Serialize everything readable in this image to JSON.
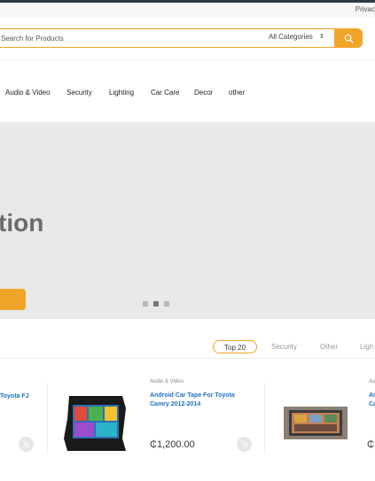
{
  "topbar": {
    "privacy_label": "Privac"
  },
  "search": {
    "placeholder": "Search for Products",
    "category_value": "All Categories",
    "category_arrow": "⇕"
  },
  "nav": {
    "items": [
      "Audio & Video",
      "Security",
      "Lighting",
      "Car Care",
      "Decor",
      "other"
    ]
  },
  "hero": {
    "title_fragment": "tion",
    "slide_count": 3,
    "active_slide": 2
  },
  "tabs": {
    "items": [
      "Top 20",
      "Security",
      "Other",
      "Ligh"
    ],
    "active_index": 0
  },
  "products": [
    {
      "category": "",
      "title_line1": "Toyota FJ",
      "title_line2": "",
      "price": ""
    },
    {
      "category": "Audio & Video",
      "title_line1": "Android Car Tape For Toyota",
      "title_line2": "Camry 2012-2014",
      "price": "₵1,200.00"
    },
    {
      "category": "Au",
      "title_line1": "An",
      "title_line2": "Ca",
      "price": "₵"
    }
  ],
  "colors": {
    "accent": "#f0a52a",
    "link": "#1e73be",
    "hero_bg": "#e9e9e9"
  }
}
